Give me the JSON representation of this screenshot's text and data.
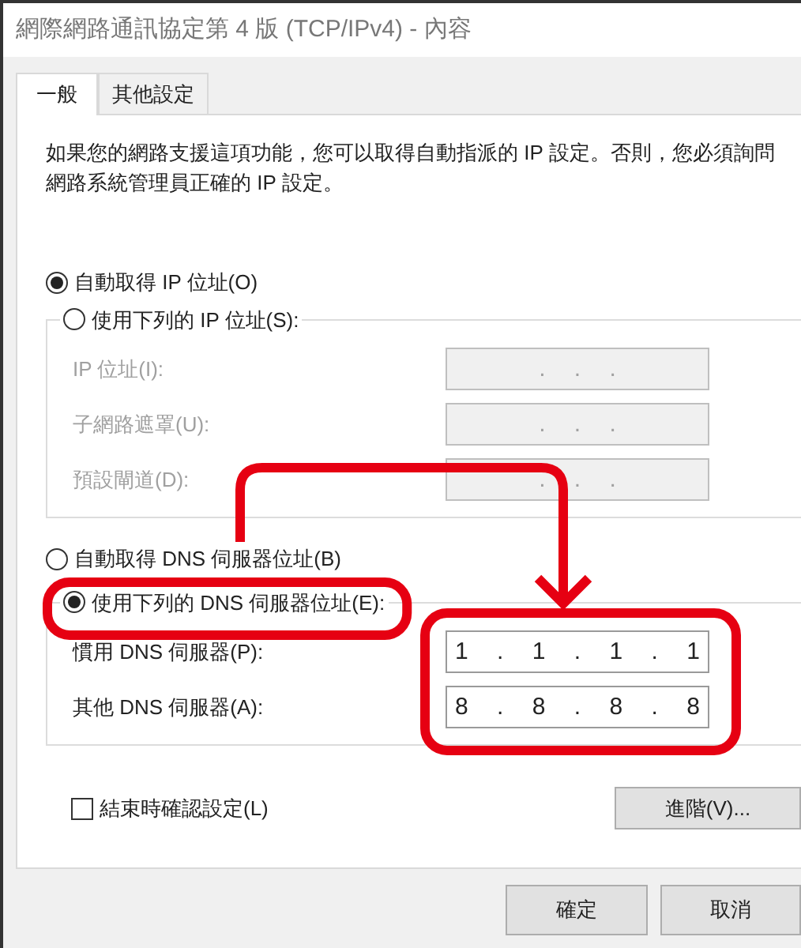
{
  "window": {
    "title": "網際網路通訊協定第 4 版 (TCP/IPv4) - 內容"
  },
  "tabs": [
    {
      "label": "一般",
      "selected": true
    },
    {
      "label": "其他設定",
      "selected": false
    }
  ],
  "description": "如果您的網路支援這項功能，您可以取得自動指派的 IP 設定。否則，您必須詢問網路系統管理員正確的 IP 設定。",
  "ip_mode": [
    {
      "label": "自動取得 IP 位址(O)",
      "selected": true
    },
    {
      "label": "使用下列的 IP 位址(S):",
      "selected": false
    }
  ],
  "ip_fields": [
    {
      "label": "IP 位址(I):",
      "value": ". . .",
      "disabled": true
    },
    {
      "label": "子網路遮罩(U):",
      "value": ". . .",
      "disabled": true
    },
    {
      "label": "預設閘道(D):",
      "value": ". . .",
      "disabled": true
    }
  ],
  "dns_mode": [
    {
      "label": "自動取得 DNS 伺服器位址(B)",
      "selected": false
    },
    {
      "label": "使用下列的 DNS 伺服器位址(E):",
      "selected": true
    }
  ],
  "dns_fields": [
    {
      "label": "慣用 DNS 伺服器(P):",
      "value": "1 . 1 . 1 . 1",
      "disabled": false
    },
    {
      "label": "其他 DNS 伺服器(A):",
      "value": "8 . 8 . 8 . 8",
      "disabled": false
    }
  ],
  "validate": {
    "label": "結束時確認設定(L)",
    "checked": false
  },
  "advanced_button": "進階(V)...",
  "buttons": [
    "確定",
    "取消"
  ]
}
